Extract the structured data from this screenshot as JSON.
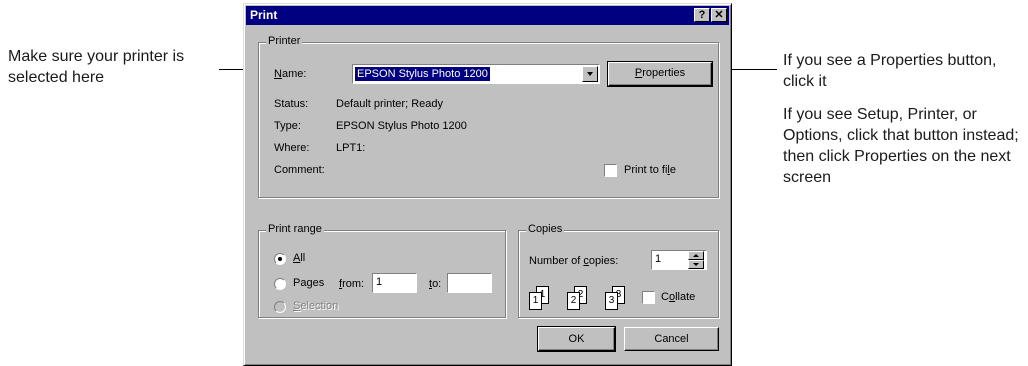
{
  "annotations": {
    "left": "Make sure your printer is selected here",
    "right_1": "If you see a Properties button, click it",
    "right_2": "If you see Setup, Printer, or Options, click that button instead; then click Properties on the next screen"
  },
  "dialog": {
    "title": "Print",
    "help_glyph": "?",
    "close_glyph": "✕",
    "printer": {
      "legend": "Printer",
      "name_label_u": "N",
      "name_label_rest": "ame:",
      "name_value": "EPSON Stylus Photo 1200",
      "properties_u": "P",
      "properties_rest": "roperties",
      "status_label": "Status:",
      "status_value": "Default printer; Ready",
      "type_label": "Type:",
      "type_value": "EPSON Stylus Photo 1200",
      "where_label": "Where:",
      "where_value": "LPT1:",
      "comment_label": "Comment:",
      "print_to_file_pre": "Print to fi",
      "print_to_file_u": "l",
      "print_to_file_post": "e"
    },
    "range": {
      "legend": "Print range",
      "all_u": "A",
      "all_rest": "ll",
      "pages": "Pages",
      "from_u": "f",
      "from_rest": "rom:",
      "from_value": "1",
      "to_u": "t",
      "to_rest": "o:",
      "to_value": "",
      "selection_u": "S",
      "selection_rest": "election",
      "selected": "all"
    },
    "copies": {
      "legend": "Copies",
      "number_pre": "Number of ",
      "number_u": "c",
      "number_post": "opies:",
      "number_value": "1",
      "collate_pre": "C",
      "collate_u": "o",
      "collate_post": "llate",
      "page_labels": [
        "1",
        "1",
        "2",
        "2",
        "3",
        "3"
      ]
    },
    "ok_label": "OK",
    "cancel_label": "Cancel"
  }
}
